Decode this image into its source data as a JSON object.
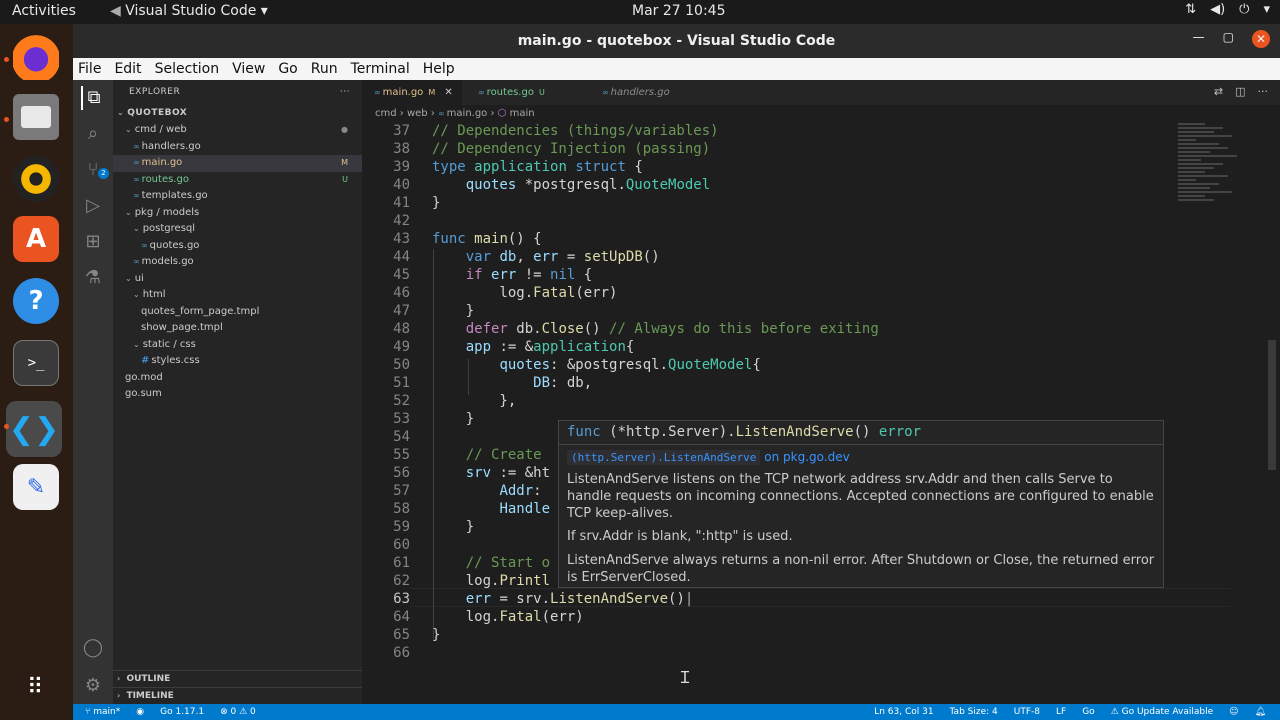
{
  "topbar": {
    "activities": "Activities",
    "app_menu": "Visual Studio Code",
    "clock": "Mar 27  10:45"
  },
  "window": {
    "title": "main.go - quotebox - Visual Studio Code"
  },
  "menu": [
    "File",
    "Edit",
    "Selection",
    "View",
    "Go",
    "Run",
    "Terminal",
    "Help"
  ],
  "activity_bar": {
    "scm_badge": "2"
  },
  "explorer": {
    "header": "EXPLORER",
    "project": "QUOTEBOX",
    "tree": [
      {
        "label": "cmd / web",
        "kind": "folder",
        "depth": 1,
        "badge": "●"
      },
      {
        "label": "handlers.go",
        "kind": "go",
        "depth": 2,
        "badge": ""
      },
      {
        "label": "main.go",
        "kind": "go",
        "depth": 2,
        "badge": "M",
        "selected": true
      },
      {
        "label": "routes.go",
        "kind": "go",
        "depth": 2,
        "badge": "U"
      },
      {
        "label": "templates.go",
        "kind": "go",
        "depth": 2,
        "badge": ""
      },
      {
        "label": "pkg / models",
        "kind": "folder",
        "depth": 1,
        "badge": ""
      },
      {
        "label": "postgresql",
        "kind": "folder",
        "depth": 2,
        "badge": ""
      },
      {
        "label": "quotes.go",
        "kind": "go",
        "depth": 3,
        "badge": ""
      },
      {
        "label": "models.go",
        "kind": "go",
        "depth": 2,
        "badge": ""
      },
      {
        "label": "ui",
        "kind": "folder",
        "depth": 1,
        "badge": ""
      },
      {
        "label": "html",
        "kind": "folder",
        "depth": 2,
        "badge": ""
      },
      {
        "label": "quotes_form_page.tmpl",
        "kind": "file",
        "depth": 3,
        "badge": ""
      },
      {
        "label": "show_page.tmpl",
        "kind": "file",
        "depth": 3,
        "badge": ""
      },
      {
        "label": "static / css",
        "kind": "folder",
        "depth": 2,
        "badge": ""
      },
      {
        "label": "styles.css",
        "kind": "css",
        "depth": 3,
        "badge": ""
      },
      {
        "label": "go.mod",
        "kind": "file",
        "depth": 1,
        "badge": ""
      },
      {
        "label": "go.sum",
        "kind": "file",
        "depth": 1,
        "badge": ""
      }
    ],
    "outline": "OUTLINE",
    "timeline": "TIMELINE"
  },
  "tabs": [
    {
      "label": "main.go",
      "badge": "M",
      "active": true
    },
    {
      "label": "routes.go",
      "badge": "U",
      "active": false
    },
    {
      "label": "handlers.go",
      "badge": "",
      "active": false
    }
  ],
  "breadcrumb": [
    "cmd",
    "web",
    "main.go",
    "main"
  ],
  "code_lines": [
    {
      "n": "37",
      "tokens": [
        [
          "cm",
          "// Dependencies (things/variables)"
        ]
      ]
    },
    {
      "n": "38",
      "tokens": [
        [
          "cm",
          "// Dependency Injection (passing)"
        ]
      ]
    },
    {
      "n": "39",
      "tokens": [
        [
          "kw",
          "type"
        ],
        [
          "",
          " "
        ],
        [
          "ty",
          "application"
        ],
        [
          "",
          " "
        ],
        [
          "kw",
          "struct"
        ],
        [
          "",
          " {"
        ]
      ]
    },
    {
      "n": "40",
      "tokens": [
        [
          "",
          "    "
        ],
        [
          "vr",
          "quotes"
        ],
        [
          "",
          " *postgresql."
        ],
        [
          "ty",
          "QuoteModel"
        ]
      ]
    },
    {
      "n": "41",
      "tokens": [
        [
          "",
          "}"
        ]
      ]
    },
    {
      "n": "42",
      "tokens": []
    },
    {
      "n": "43",
      "tokens": [
        [
          "kw",
          "func"
        ],
        [
          "",
          " "
        ],
        [
          "fn",
          "main"
        ],
        [
          "",
          "() {"
        ]
      ]
    },
    {
      "n": "44",
      "tokens": [
        [
          "",
          "    "
        ],
        [
          "kw",
          "var"
        ],
        [
          "",
          " "
        ],
        [
          "vr",
          "db"
        ],
        [
          "",
          ", "
        ],
        [
          "vr",
          "err"
        ],
        [
          "",
          " = "
        ],
        [
          "fn",
          "setUpDB"
        ],
        [
          "",
          "()"
        ]
      ]
    },
    {
      "n": "45",
      "tokens": [
        [
          "",
          "    "
        ],
        [
          "ctl",
          "if"
        ],
        [
          "",
          " "
        ],
        [
          "vr",
          "err"
        ],
        [
          "",
          " != "
        ],
        [
          "kw",
          "nil"
        ],
        [
          "",
          " {"
        ]
      ]
    },
    {
      "n": "46",
      "tokens": [
        [
          "",
          "        log."
        ],
        [
          "fn",
          "Fatal"
        ],
        [
          "",
          "(err)"
        ]
      ]
    },
    {
      "n": "47",
      "tokens": [
        [
          "",
          "    }"
        ]
      ]
    },
    {
      "n": "48",
      "tokens": [
        [
          "",
          "    "
        ],
        [
          "ctl",
          "defer"
        ],
        [
          "",
          " db."
        ],
        [
          "fn",
          "Close"
        ],
        [
          "",
          "() "
        ],
        [
          "cm",
          "// Always do this before exiting"
        ]
      ]
    },
    {
      "n": "49",
      "tokens": [
        [
          "",
          "    "
        ],
        [
          "vr",
          "app"
        ],
        [
          "",
          " := &"
        ],
        [
          "ty",
          "application"
        ],
        [
          "",
          "{"
        ]
      ]
    },
    {
      "n": "50",
      "tokens": [
        [
          "",
          "        "
        ],
        [
          "vr",
          "quotes"
        ],
        [
          "",
          ": &postgresql."
        ],
        [
          "ty",
          "QuoteModel"
        ],
        [
          "",
          "{"
        ]
      ]
    },
    {
      "n": "51",
      "tokens": [
        [
          "",
          "            "
        ],
        [
          "vr",
          "DB"
        ],
        [
          "",
          ": db,"
        ]
      ]
    },
    {
      "n": "52",
      "tokens": [
        [
          "",
          "        },"
        ]
      ]
    },
    {
      "n": "53",
      "tokens": [
        [
          "",
          "    }"
        ]
      ]
    },
    {
      "n": "54",
      "tokens": []
    },
    {
      "n": "55",
      "tokens": [
        [
          "",
          "    "
        ],
        [
          "cm",
          "// Create"
        ]
      ]
    },
    {
      "n": "56",
      "tokens": [
        [
          "",
          "    "
        ],
        [
          "vr",
          "srv"
        ],
        [
          "",
          " := &ht"
        ]
      ]
    },
    {
      "n": "57",
      "tokens": [
        [
          "",
          "        "
        ],
        [
          "vr",
          "Addr"
        ],
        [
          "",
          ":"
        ]
      ]
    },
    {
      "n": "58",
      "tokens": [
        [
          "",
          "        "
        ],
        [
          "vr",
          "Handle"
        ]
      ]
    },
    {
      "n": "59",
      "tokens": [
        [
          "",
          "    }"
        ]
      ]
    },
    {
      "n": "60",
      "tokens": []
    },
    {
      "n": "61",
      "tokens": [
        [
          "",
          "    "
        ],
        [
          "cm",
          "// Start o"
        ]
      ]
    },
    {
      "n": "62",
      "tokens": [
        [
          "",
          "    log."
        ],
        [
          "fn",
          "Printl"
        ]
      ]
    },
    {
      "n": "63",
      "tokens": [
        [
          "",
          "    "
        ],
        [
          "vr",
          "err"
        ],
        [
          "",
          " = srv."
        ],
        [
          "fn",
          "ListenAndServe"
        ],
        [
          "",
          "()"
        ]
      ]
    },
    {
      "n": "64",
      "tokens": [
        [
          "",
          "    log."
        ],
        [
          "fn",
          "Fatal"
        ],
        [
          "",
          "(err)"
        ]
      ]
    },
    {
      "n": "65",
      "tokens": [
        [
          "",
          "}"
        ]
      ]
    },
    {
      "n": "66",
      "tokens": []
    }
  ],
  "current_line": "63",
  "hover": {
    "signature_func": "func",
    "signature_recv": " (*http.Server).",
    "signature_name": "ListenAndServe",
    "signature_tail": "() ",
    "signature_ret": "error",
    "link_code": "(http.Server).ListenAndServe",
    "link_text": "on pkg.go.dev",
    "para1": "ListenAndServe listens on the TCP network address srv.Addr and then calls Serve to handle requests on incoming connections. Accepted connections are configured to enable TCP keep-alives.",
    "para2": "If srv.Addr is blank, \":http\" is used.",
    "para3": "ListenAndServe always returns a non-nil error. After Shutdown or Close, the returned error is ErrServerClosed."
  },
  "status": {
    "branch": "main*",
    "go_version": "Go 1.17.1",
    "problems": "⊗ 0 ⚠ 0",
    "position": "Ln 63, Col 31",
    "tab_size": "Tab Size: 4",
    "encoding": "UTF-8",
    "eol": "LF",
    "language": "Go",
    "update": "Go Update Available"
  },
  "colors": {
    "accent": "#007acc",
    "keyword": "#569cd6",
    "comment": "#6a9955",
    "type": "#4ec9b0",
    "function": "#dcdcaa"
  }
}
